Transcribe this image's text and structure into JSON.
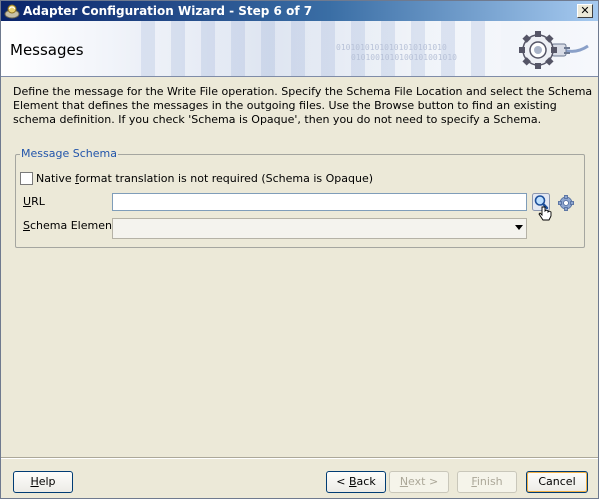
{
  "window": {
    "title": "Adapter Configuration Wizard - Step 6 of 7",
    "close_glyph": "✕"
  },
  "header": {
    "title": "Messages",
    "binary_line_1": "01010101010101010101010",
    "binary_line_2": "0101001010100101001010"
  },
  "description": "Define the message for the Write File operation.  Specify the Schema File Location and select the Schema Element that defines the messages in the outgoing files. Use the Browse button to find an existing schema definition. If you check 'Schema is Opaque', then you do not need to specify a Schema.",
  "message_schema": {
    "legend": "Message Schema",
    "opaque_checkbox": {
      "checked": false,
      "label_pre": "Native ",
      "label_accel": "f",
      "label_post": "ormat translation is not required (Schema is Opaque)"
    },
    "url": {
      "label_accel": "U",
      "label_post": "RL",
      "value": ""
    },
    "schema_element": {
      "label_accel": "S",
      "label_post": "chema Element",
      "selected": ""
    }
  },
  "buttons": {
    "help": {
      "accel": "H",
      "rest": "elp"
    },
    "back": {
      "pre": "< ",
      "accel": "B",
      "rest": "ack"
    },
    "next": {
      "accel": "N",
      "rest": "ext >"
    },
    "finish": {
      "accel": "F",
      "rest": "inish"
    },
    "cancel": {
      "label": "Cancel"
    }
  },
  "icons": {
    "title": "wizard-app-icon",
    "header": "gear-plug-graphic",
    "browse": "magnifier-search-icon",
    "settings": "gear-icon",
    "cursor": "hand-pointer-cursor"
  }
}
